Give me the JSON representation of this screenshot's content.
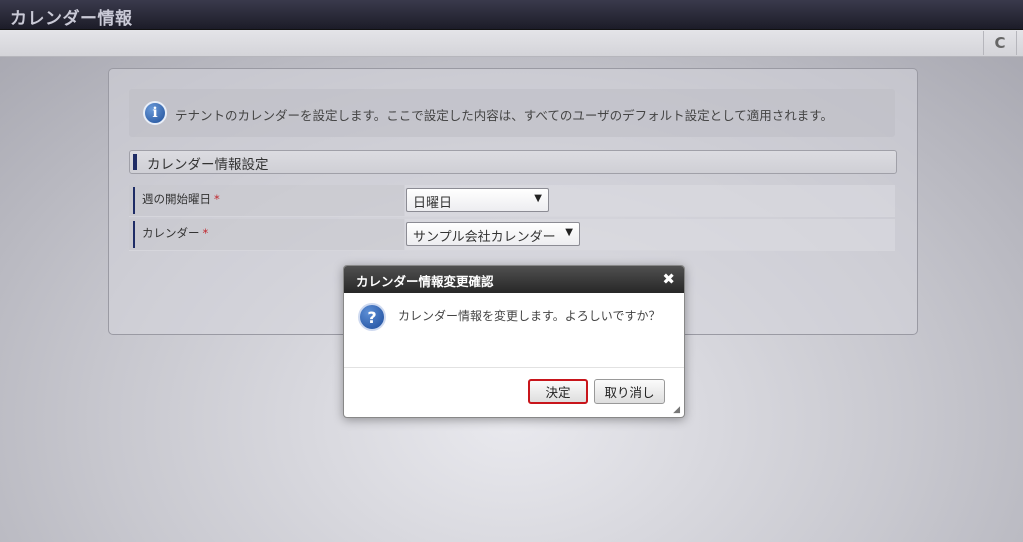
{
  "window": {
    "title": "カレンダー情報"
  },
  "toolbar": {
    "refresh_icon": "refresh-icon",
    "refresh_glyph": "C"
  },
  "info": {
    "icon": "info-icon",
    "glyph": "i",
    "text": "テナントのカレンダーを設定します。ここで設定した内容は、すべてのユーザのデフォルト設定として適用されます。"
  },
  "section": {
    "title": "カレンダー情報設定"
  },
  "form": {
    "required_mark": "*",
    "rows": [
      {
        "label": "週の開始曜日",
        "value": "日曜日"
      },
      {
        "label": "カレンダー",
        "value": "サンプル会社カレンダー"
      }
    ],
    "dropdown_glyph": "▼"
  },
  "dialog": {
    "title": "カレンダー情報変更確認",
    "close_glyph": "✖",
    "icon": "question-icon",
    "icon_glyph": "?",
    "message": "カレンダー情報を変更します。よろしいですか？",
    "ok_label": "決定",
    "cancel_label": "取り消し",
    "resize_glyph": "◢"
  },
  "colors": {
    "title_bar": "#1c1c28",
    "accent_bar": "#1e2c66",
    "required": "#c0262d",
    "ok_highlight": "#c8151b"
  }
}
